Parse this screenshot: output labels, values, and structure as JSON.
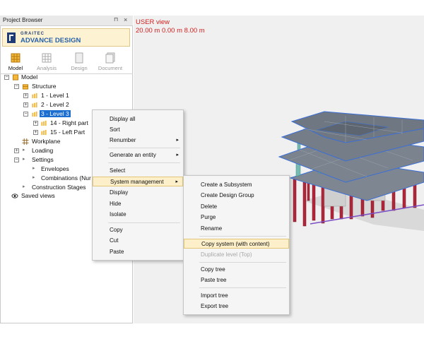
{
  "panel": {
    "title": "Project Browser",
    "pin": "⊓",
    "close": "×"
  },
  "logo": {
    "company": "GRAITEC",
    "product": "ADVANCE DESIGN"
  },
  "modes": [
    {
      "label": "Model",
      "icon": "model-icon"
    },
    {
      "label": "Analysis",
      "icon": "analysis-icon"
    },
    {
      "label": "Design",
      "icon": "design-icon"
    },
    {
      "label": "Document",
      "icon": "document-icon"
    }
  ],
  "tree": {
    "model": "Model",
    "structure": "Structure",
    "level1": "1 - Level 1",
    "level2": "2 - Level 2",
    "level3": "3 - Level 3",
    "right_part": "14 - Right part",
    "left_part": "15 - Left Part",
    "workplane": "Workplane",
    "loading": "Loading",
    "settings": "Settings",
    "envelopes": "Envelopes",
    "combinations": "Combinations (Nur",
    "construction_stages": "Construction Stages",
    "saved_views": "Saved views"
  },
  "viewport": {
    "title": "USER view",
    "coords": "20.00 m  0.00 m  8.00 m"
  },
  "context_menu": {
    "items": [
      {
        "label": "Display all"
      },
      {
        "label": "Sort"
      },
      {
        "label": "Renumber",
        "submenu": "▸"
      },
      {
        "label": "Generate an entity",
        "submenu": "▸"
      },
      {
        "label": "Select"
      },
      {
        "label": "System management",
        "submenu": "▸"
      },
      {
        "label": "Display"
      },
      {
        "label": "Hide"
      },
      {
        "label": "Isolate"
      },
      {
        "label": "Copy"
      },
      {
        "label": "Cut"
      },
      {
        "label": "Paste"
      }
    ]
  },
  "submenu": {
    "items": [
      {
        "label": "Create a Subsystem"
      },
      {
        "label": "Create Design Group"
      },
      {
        "label": "Delete"
      },
      {
        "label": "Purge"
      },
      {
        "label": "Rename"
      },
      {
        "label": "Copy system (with content)"
      },
      {
        "label": "Duplicate level (Top)"
      },
      {
        "label": "Copy tree"
      },
      {
        "label": "Paste tree"
      },
      {
        "label": "Import tree"
      },
      {
        "label": "Export tree"
      }
    ]
  },
  "colors": {
    "selection": "#1c6ed1",
    "highlight": "#fcefc9",
    "viewport_text": "#d21f1f",
    "column": "#b3263a",
    "slab_edge": "#3b6fd6",
    "wall": "#6fb8b0"
  }
}
